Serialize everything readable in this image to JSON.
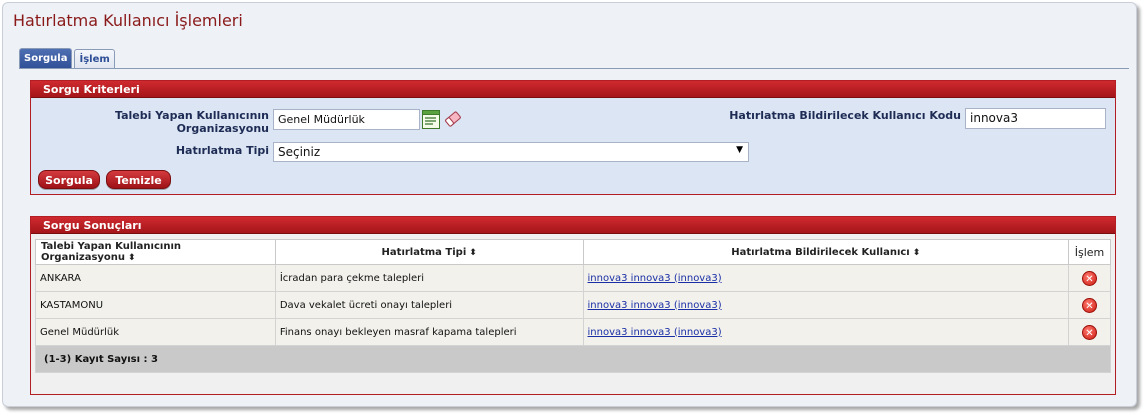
{
  "page": {
    "title": "Hatırlatma Kullanıcı İşlemleri"
  },
  "tabs": [
    {
      "label": "Sorgula",
      "active": true
    },
    {
      "label": "İşlem",
      "active": false
    }
  ],
  "criteria": {
    "header": "Sorgu Kriterleri",
    "org_label": "Talebi Yapan Kullanıcının Organizasyonu",
    "org_value": "Genel Müdürlük",
    "user_label": "Hatırlatma Bildirilecek Kullanıcı Kodu",
    "user_value": "innova3",
    "type_label": "Hatırlatma Tipi",
    "type_value": "Seçiniz",
    "query_button": "Sorgula",
    "clear_button": "Temizle"
  },
  "results": {
    "header": "Sorgu Sonuçları",
    "columns": [
      "Talebi Yapan Kullanıcının Organizasyonu",
      "Hatırlatma Tipi",
      "Hatırlatma Bildirilecek Kullanıcı",
      "İşlem"
    ],
    "sort_glyph": "⬍",
    "rows": [
      {
        "org": "ANKARA",
        "type": "İcradan para çekme talepleri",
        "user": "innova3 innova3 (innova3)"
      },
      {
        "org": "KASTAMONU",
        "type": "Dava vekalet ücreti onayı talepleri",
        "user": "innova3 innova3 (innova3)"
      },
      {
        "org": "Genel Müdürlük",
        "type": "Finans onayı bekleyen masraf kapama talepleri",
        "user": "innova3 innova3 (innova3)"
      }
    ],
    "delete_glyph": "✕",
    "footer": "(1-3) Kayıt Sayısı : 3"
  },
  "icons": {
    "list_picker": "list-picker-icon",
    "eraser": "eraser-icon",
    "delete": "delete-icon"
  },
  "colors": {
    "panel_header": "#b31e24",
    "title": "#8a1a1a",
    "tab_active": "#2e4e96",
    "link": "#1a2fa6"
  }
}
